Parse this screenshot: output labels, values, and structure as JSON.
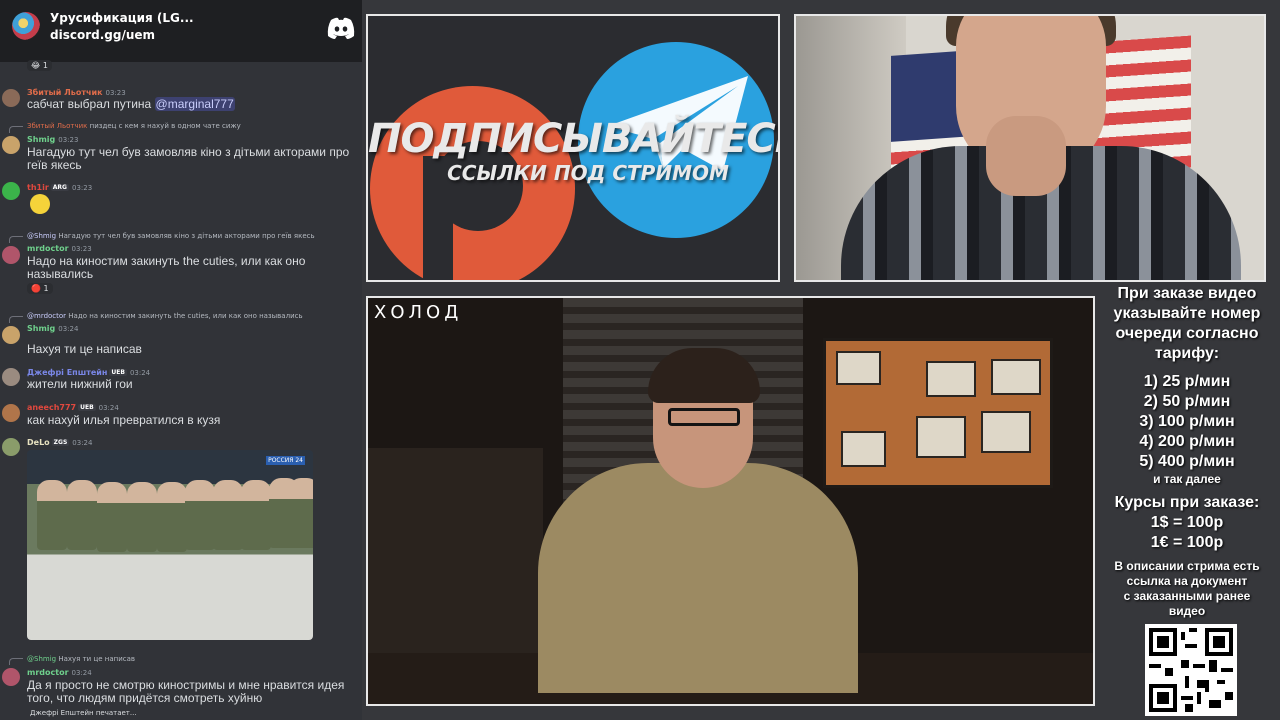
{
  "server": {
    "name": "Урусификация (LG...",
    "invite": "discord.gg/uem"
  },
  "chat": {
    "messages": [
      {
        "author": "Збитый Льотчик",
        "time": "03:23",
        "text": "сабчат выбрал путина",
        "mention": "@marginal777"
      },
      {
        "reply_author": "Збитый Льотчик",
        "reply_text": "пиздец с кем я нахуй в одном чате сижу",
        "author": "Shmig",
        "time": "03:23",
        "text": "Нагадую тут чел був замовляв кіно з дітьми акторами про геїв якесь"
      },
      {
        "author": "th1ir",
        "badge": "ARG",
        "time": "03:23"
      },
      {
        "reply_author": "@Shmig",
        "reply_text": "Нагадую тут чел був замовляв кіно з дітьми акторами про геїв якесь",
        "author": "mrdoctor",
        "time": "03:23",
        "text": "Надо на киностим закинуть the cuties, или как оно назывались",
        "reaction_count": "1"
      },
      {
        "reply_author": "@mrdoctor",
        "reply_text": "Надо на киностим закинуть the cuties, или как оно назывались",
        "author": "Shmig",
        "time": "03:24",
        "text": "Нахуя ти це написав"
      },
      {
        "author": "Джефрі Епштейн",
        "badge": "UEB",
        "time": "03:24",
        "text": "жители нижний гои"
      },
      {
        "author": "aneech777",
        "badge": "UEB",
        "time": "03:24",
        "text": "как нахуй илья превратился в кузя"
      },
      {
        "author": "DeLo",
        "badge": "ZGS",
        "time": "03:24"
      },
      {
        "reply_author": "@Shmig",
        "reply_text": "Нахуя ти це написав",
        "author": "mrdoctor",
        "time": "03:24",
        "text": "Да я просто не смотрю киностримы и мне нравится идея того, что людям придётся смотреть хуйню"
      }
    ],
    "top_reaction_count": "1",
    "meme_logo": "РОССИЯ 24",
    "typing": "Джефрі Епштейн печатает..."
  },
  "promo": {
    "title": "ПОДПИСЫВАЙТЕСЬ",
    "subtitle": "ССЫЛКИ ПОД СТРИМОМ"
  },
  "video": {
    "logo": "ХОЛОД"
  },
  "info": {
    "intro": [
      "При заказе видео",
      "указывайте номер",
      "очереди согласно",
      "тарифу:"
    ],
    "tariffs": [
      "1) 25 р/мин",
      "2) 50 р/мин",
      "3) 100 р/мин",
      "4) 200 р/мин",
      "5) 400 р/мин"
    ],
    "etc": "и так далее",
    "rates_title": "Курсы при заказе:",
    "rates": [
      "1$ = 100р",
      "1€ = 100р"
    ],
    "note": [
      "В описании стрима есть",
      "ссылка на документ",
      "с заказанными ранее",
      "видео"
    ]
  },
  "colors": {
    "patreon": "#e05a3a",
    "telegram": "#2aa1df",
    "discord_bg": "#313338"
  }
}
